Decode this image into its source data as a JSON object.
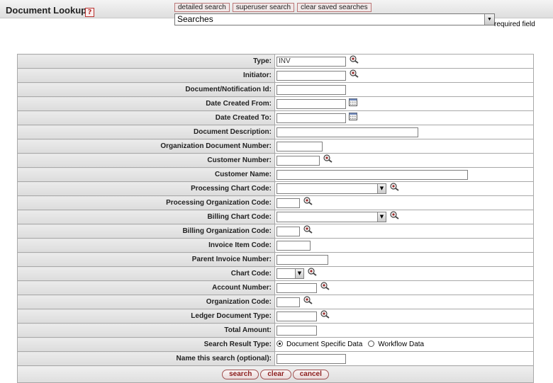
{
  "header": {
    "title": "Document Lookup",
    "help_glyph": "?",
    "links": [
      "detailed search",
      "superuser search",
      "clear saved searches"
    ],
    "saved_search_select": "Searches",
    "required_note": "required field"
  },
  "fields": [
    {
      "label": "Type:",
      "control": "text",
      "width": 98,
      "value": "INV",
      "icon": "lookup"
    },
    {
      "label": "Initiator:",
      "control": "text",
      "width": 98,
      "value": "",
      "icon": "lookup"
    },
    {
      "label": "Document/Notification Id:",
      "control": "text",
      "width": 98,
      "value": "",
      "icon": ""
    },
    {
      "label": "Date Created From:",
      "control": "text",
      "width": 98,
      "value": "",
      "icon": "calendar"
    },
    {
      "label": "Date Created To:",
      "control": "text",
      "width": 98,
      "value": "",
      "icon": "calendar"
    },
    {
      "label": "Document Description:",
      "control": "text",
      "width": 200,
      "value": "",
      "icon": ""
    },
    {
      "label": "Organization Document Number:",
      "control": "text",
      "width": 65,
      "value": "",
      "icon": ""
    },
    {
      "label": "Customer Number:",
      "control": "text",
      "width": 61,
      "value": "",
      "icon": "lookup"
    },
    {
      "label": "Customer Name:",
      "control": "text",
      "width": 270,
      "value": "",
      "icon": ""
    },
    {
      "label": "Processing Chart Code:",
      "control": "select",
      "width": 155,
      "value": "",
      "icon": "lookup"
    },
    {
      "label": "Processing Organization Code:",
      "control": "text",
      "width": 33,
      "value": "",
      "icon": "lookup"
    },
    {
      "label": "Billing Chart Code:",
      "control": "select",
      "width": 155,
      "value": "",
      "icon": "lookup"
    },
    {
      "label": "Billing Organization Code:",
      "control": "text",
      "width": 33,
      "value": "",
      "icon": "lookup"
    },
    {
      "label": "Invoice Item Code:",
      "control": "text",
      "width": 48,
      "value": "",
      "icon": ""
    },
    {
      "label": "Parent Invoice Number:",
      "control": "text",
      "width": 73,
      "value": "",
      "icon": ""
    },
    {
      "label": "Chart Code:",
      "control": "select",
      "width": 39,
      "value": "",
      "icon": "lookup"
    },
    {
      "label": "Account Number:",
      "control": "text",
      "width": 57,
      "value": "",
      "icon": "lookup"
    },
    {
      "label": "Organization Code:",
      "control": "text",
      "width": 33,
      "value": "",
      "icon": "lookup"
    },
    {
      "label": "Ledger Document Type:",
      "control": "text",
      "width": 57,
      "value": "",
      "icon": "lookup"
    },
    {
      "label": "Total Amount:",
      "control": "text",
      "width": 57,
      "value": "",
      "icon": ""
    },
    {
      "label": "Search Result Type:",
      "control": "radio",
      "options": [
        "Document Specific Data",
        "Workflow Data"
      ],
      "selected": 0
    },
    {
      "label": "Name this search (optional):",
      "control": "text",
      "width": 98,
      "value": "",
      "icon": ""
    }
  ],
  "buttons": [
    "search",
    "clear",
    "cancel"
  ],
  "colors": {
    "button_text": "#8b1a1a",
    "button_border": "#a05050",
    "label_bg": "#e3e3e3"
  }
}
